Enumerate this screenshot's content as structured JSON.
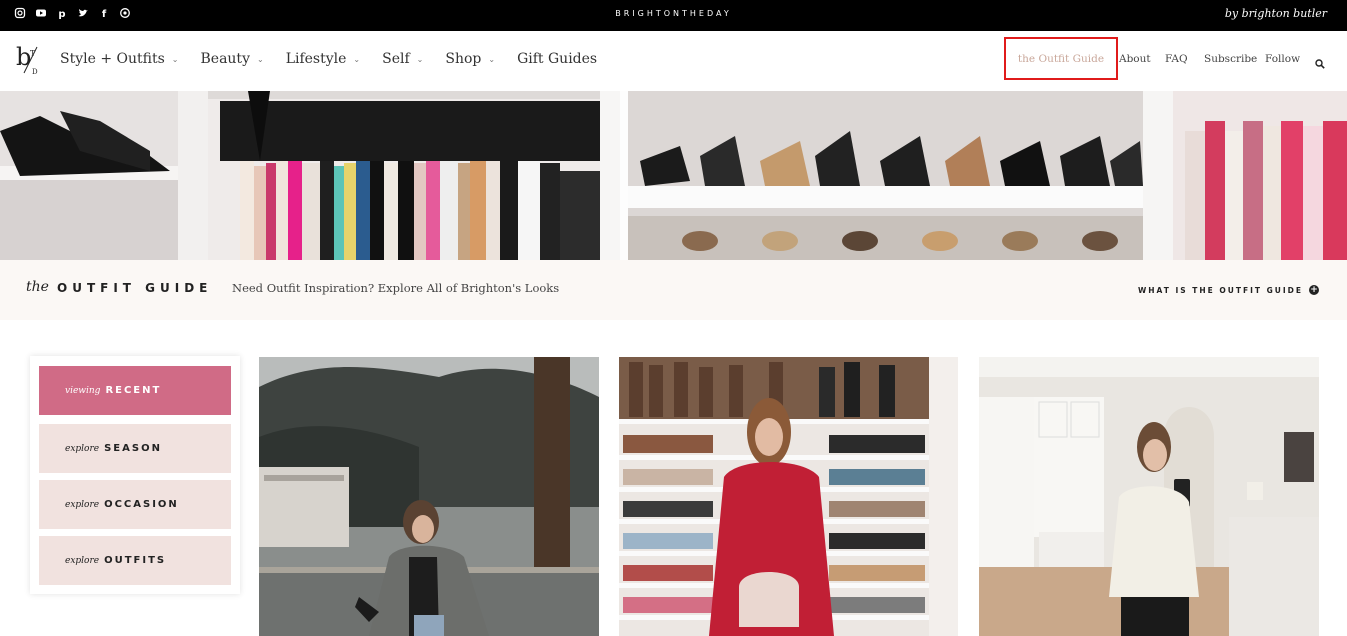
{
  "topbar": {
    "social_icons": [
      "instagram-icon",
      "youtube-icon",
      "pinterest-icon",
      "twitter-icon",
      "facebook-icon",
      "email-icon"
    ],
    "site_name": "BRIGHTONTHEDAY",
    "byline": "by brighton butler"
  },
  "nav": {
    "logo_alt": "b/T D",
    "items": [
      {
        "label": "Style + Outfits",
        "has_dropdown": true
      },
      {
        "label": "Beauty",
        "has_dropdown": true
      },
      {
        "label": "Lifestyle",
        "has_dropdown": true
      },
      {
        "label": "Self",
        "has_dropdown": true
      },
      {
        "label": "Shop",
        "has_dropdown": true
      },
      {
        "label": "Gift Guides",
        "has_dropdown": false
      }
    ],
    "right_links": {
      "outfit_guide": "the Outfit Guide",
      "about": "About",
      "faq": "FAQ",
      "subscribe": "Subscribe",
      "follow": "Follow"
    },
    "dropdown_glyph": "⌄"
  },
  "guide": {
    "the": "the",
    "title": "OUTFIT GUIDE",
    "tagline": "Need Outfit Inspiration? Explore All of Brighton's Looks",
    "what_link": "WHAT IS THE OUTFIT GUIDE",
    "what_icon": "+"
  },
  "filters": [
    {
      "prefix": "viewing",
      "label": "RECENT",
      "active": true
    },
    {
      "prefix": "explore",
      "label": "SEASON",
      "active": false
    },
    {
      "prefix": "explore",
      "label": "OCCASION",
      "active": false
    },
    {
      "prefix": "explore",
      "label": "OUTFITS",
      "active": false
    }
  ],
  "colors": {
    "accent_pink": "#d06b86",
    "filter_bg": "#f1e2df",
    "outfit_link": "#c9a79a",
    "highlight_box": "#e01b1b"
  }
}
